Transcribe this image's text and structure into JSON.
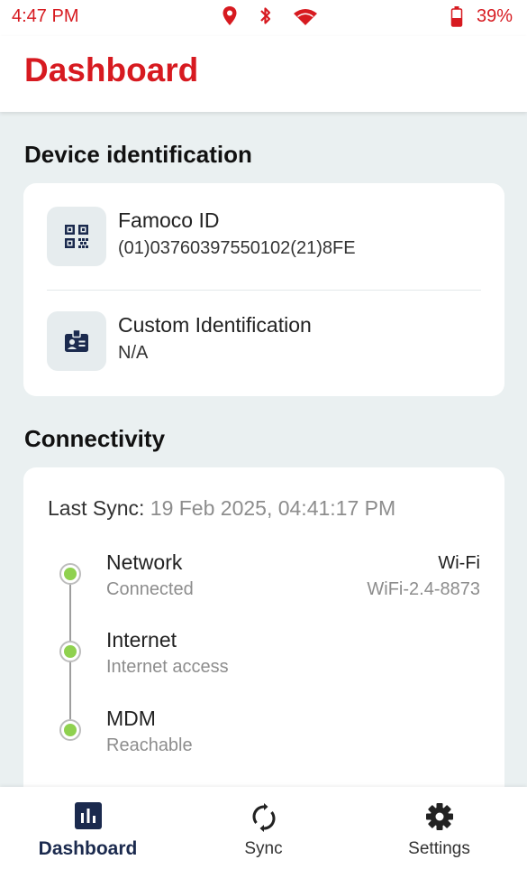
{
  "status_bar": {
    "time": "4:47 PM",
    "icons": [
      "location-icon",
      "bluetooth-icon",
      "wifi-icon",
      "battery-icon"
    ],
    "battery": "39%",
    "color": "#d71a20"
  },
  "app_bar": {
    "title": "Dashboard",
    "title_color": "#d71a20"
  },
  "device_identification": {
    "title": "Device identification",
    "items": [
      {
        "icon": "qr-code-icon",
        "label": "Famoco ID",
        "value": "(01)03760397550102(21)8FE"
      },
      {
        "icon": "id-badge-icon",
        "label": "Custom Identification",
        "value": "N/A"
      }
    ]
  },
  "connectivity": {
    "title": "Connectivity",
    "last_sync_label": "Last Sync:",
    "last_sync_value": "19 Feb 2025, 04:41:17 PM",
    "items": [
      {
        "label": "Network",
        "status": "Connected",
        "detail_title": "Wi-Fi",
        "detail_sub": "WiFi-2.4-8873"
      },
      {
        "label": "Internet",
        "status": "Internet access"
      },
      {
        "label": "MDM",
        "status": "Reachable"
      }
    ],
    "status_color": "#8fd14f"
  },
  "bottom_nav": {
    "items": [
      {
        "icon": "dashboard-icon",
        "label": "Dashboard",
        "active": true
      },
      {
        "icon": "sync-icon",
        "label": "Sync",
        "active": false
      },
      {
        "icon": "settings-gear-icon",
        "label": "Settings",
        "active": false
      }
    ],
    "active_color": "#1b2a4e"
  }
}
